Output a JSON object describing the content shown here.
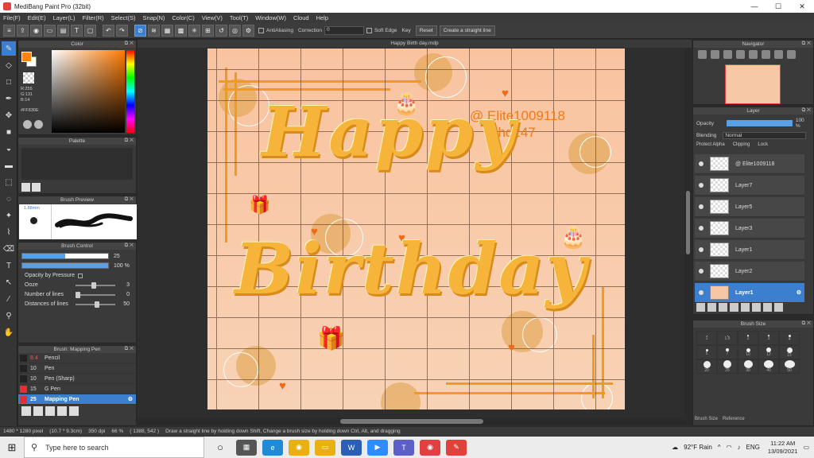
{
  "window": {
    "title": "MediBang Paint Pro (32bit)",
    "controls": [
      "—",
      "☐",
      "✕"
    ]
  },
  "menu": [
    "File(F)",
    "Edit(E)",
    "Layer(L)",
    "Filter(R)",
    "Select(S)",
    "Snap(N)",
    "Color(C)",
    "View(V)",
    "Tool(T)",
    "Window(W)",
    "Cloud",
    "Help"
  ],
  "toolbar": {
    "antialiasing_label": "AntiAliasing",
    "correction_label": "Correction",
    "correction_value": "0",
    "soft_edge_label": "Soft Edge",
    "key_label": "Key",
    "reset_label": "Reset",
    "straight_line_label": "Create a straight line"
  },
  "color_panel": {
    "title": "Color",
    "fg_color": "#FF830E",
    "rgb_r": "R:255",
    "rgb_g": "G:131",
    "rgb_b": "B:14",
    "hex": "#FF830E"
  },
  "palette_panel": {
    "title": "Palette"
  },
  "brush_preview": {
    "title": "Brush Preview",
    "size_label": "1.88mm"
  },
  "brush_control": {
    "title": "Brush Control",
    "size_value": "25",
    "opacity_value": "100 %",
    "opacity_by_pressure": "Opacity by Pressure",
    "ooze_label": "Ooze",
    "ooze_value": "3",
    "lines_label": "Number of lines",
    "lines_value": "0",
    "distance_label": "Distances of lines",
    "distance_value": "50"
  },
  "brush_list": {
    "title": "Brush: Mapping Pen",
    "items": [
      {
        "size": "8.4",
        "name": "Pencil",
        "color": "#222222"
      },
      {
        "size": "10",
        "name": "Pen",
        "color": "#222222"
      },
      {
        "size": "10",
        "name": "Pen (Sharp)",
        "color": "#222222"
      },
      {
        "size": "15",
        "name": "G Pen",
        "color": "#e03030"
      },
      {
        "size": "25",
        "name": "Mapping Pen",
        "color": "#e03030"
      }
    ]
  },
  "canvas": {
    "doc_title": "Happy Birth day.mdp",
    "happy": "Happy",
    "birthday": "Birthday",
    "handle": "@ Elite1009118",
    "hashtag": "#hd247"
  },
  "navigator": {
    "title": "Navigator"
  },
  "layer_panel": {
    "title": "Layer",
    "opacity_label": "Opacity",
    "opacity_value": "100 %",
    "blending_label": "Blending",
    "blending_value": "Normal",
    "protect_alpha": "Protect Alpha",
    "clipping": "Clipping",
    "lock": "Lock",
    "layers": [
      "@ Elite1009118",
      "Layer7",
      "Layer5",
      "Layer3",
      "Layer1",
      "Layer2",
      "Layer1"
    ]
  },
  "brush_size": {
    "title": "Brush Size",
    "sizes": [
      "1",
      "1.5",
      "2",
      "3",
      "4",
      "5",
      "7",
      "10",
      "12",
      "15",
      "20",
      "25",
      "30",
      "40",
      "50"
    ],
    "tab1": "Brush Size",
    "tab2": "Reference"
  },
  "status": {
    "dimensions": "1480 * 1280 pixel",
    "size_cm": "(10.7 * 9.3cm)",
    "dpi": "350 dpi",
    "zoom": "66 %",
    "coords": "( 1388, 542 )",
    "hint": "Draw a straight line by holding down Shift, Change a brush size by holding down Ctrl, Alt, and dragging"
  },
  "taskbar": {
    "search_placeholder": "Type here to search",
    "weather": "92°F Rain",
    "lang": "ENG",
    "time": "11:22 AM",
    "date": "13/09/2021"
  }
}
